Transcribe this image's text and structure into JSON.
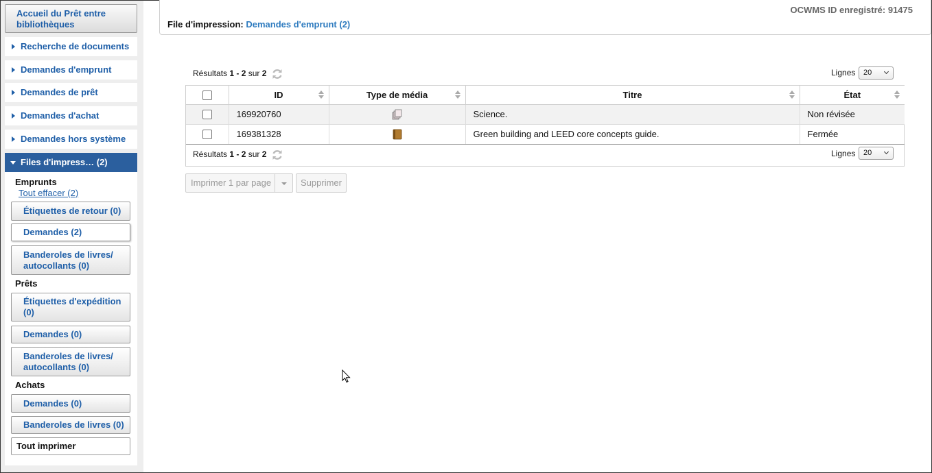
{
  "sidebar": {
    "home_label": "Accueil du Prêt entre bibliothèques",
    "nav": [
      {
        "label": "Recherche de documents"
      },
      {
        "label": "Demandes d'emprunt"
      },
      {
        "label": "Demandes de prêt"
      },
      {
        "label": "Demandes d'achat"
      },
      {
        "label": "Demandes hors système"
      }
    ],
    "active_label": "Files d'impress… (2)",
    "borrowing": {
      "heading": "Emprunts",
      "clear_all": "Tout effacer (2)",
      "buttons": [
        "Étiquettes de retour (0)",
        "Demandes (2)",
        "Banderoles de livres/ autocollants (0)"
      ]
    },
    "lending": {
      "heading": "Prêts",
      "buttons": [
        "Étiquettes d'expédition (0)",
        "Demandes (0)",
        "Banderoles de livres/ autocollants (0)"
      ]
    },
    "purchase": {
      "heading": "Achats",
      "buttons": [
        "Demandes (0)",
        "Banderoles de livres (0)"
      ]
    },
    "print_all": "Tout imprimer"
  },
  "header": {
    "ocwms": "OCWMS ID enregistré: 91475",
    "queue_prefix": "File d'impression:",
    "queue_link": "Demandes d'emprunt (2)"
  },
  "results": {
    "prefix": "Résultats",
    "range": "1 - 2",
    "of": "sur",
    "total": "2"
  },
  "lines": {
    "label": "Lignes",
    "value": "20"
  },
  "table": {
    "columns": [
      "ID",
      "Type de média",
      "Titre",
      "État"
    ],
    "rows": [
      {
        "id": "169920760",
        "media_icon": "serial-icon",
        "title": "Science.",
        "status": "Non révisée"
      },
      {
        "id": "169381328",
        "media_icon": "book-icon",
        "title": "Green building and LEED core concepts guide.",
        "status": "Fermée"
      }
    ]
  },
  "actions": {
    "print_one": "Imprimer 1 par page",
    "delete": "Supprimer"
  },
  "colors": {
    "link_blue": "#1f5fa8",
    "active_nav": "#2b5f9e"
  }
}
